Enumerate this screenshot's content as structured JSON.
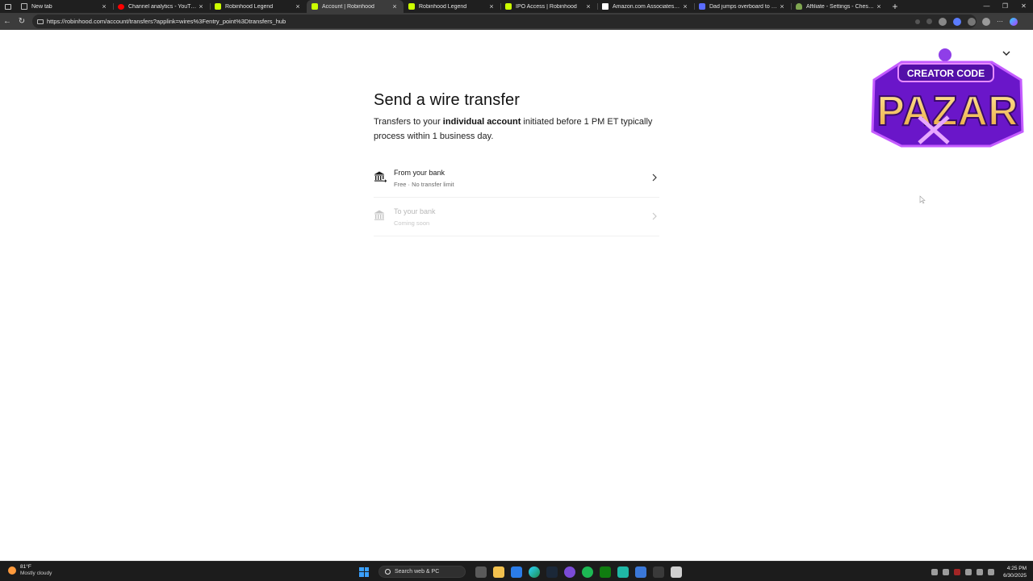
{
  "browser": {
    "tabs": [
      {
        "title": "New tab",
        "favicon": "page-icon",
        "active": false
      },
      {
        "title": "Channel analytics - YouTube Studio",
        "favicon": "youtube-icon",
        "active": false
      },
      {
        "title": "Robinhood Legend",
        "favicon": "robinhood-icon",
        "active": false
      },
      {
        "title": "Account | Robinhood",
        "favicon": "robinhood-icon",
        "active": true
      },
      {
        "title": "Robinhood Legend",
        "favicon": "robinhood-icon",
        "active": false
      },
      {
        "title": "IPO Access | Robinhood",
        "favicon": "robinhood-icon",
        "active": false
      },
      {
        "title": "Amazon.com Associates Central",
        "favicon": "amazon-icon",
        "active": false
      },
      {
        "title": "Dad jumps overboard to save daughter",
        "favicon": "news-icon",
        "active": false
      },
      {
        "title": "Affiliate - Settings - Chess.com",
        "favicon": "chess-icon",
        "active": false
      }
    ],
    "new_tab": "+",
    "url": "https://robinhood.com/account/transfers?applink=wires%3Fentry_point%3Dtransfers_hub"
  },
  "page": {
    "title": "Send a wire transfer",
    "subtitle_pre": "Transfers to your ",
    "subtitle_bold": "individual account",
    "subtitle_post": " initiated before 1 PM ET typically process within 1 business day.",
    "options": [
      {
        "label": "From your bank",
        "sub": "Free · No transfer limit",
        "disabled": false
      },
      {
        "label": "To your bank",
        "sub": "Coming soon",
        "disabled": true
      }
    ]
  },
  "overlay": {
    "top_text": "CREATOR CODE",
    "main_text": "PAZAR",
    "colors": {
      "purple": "#7a1fd6",
      "gold": "#f5c04a"
    }
  },
  "taskbar": {
    "weather_temp": "81°F",
    "weather_desc": "Mostly cloudy",
    "search_placeholder": "Search web & PC",
    "time": "4:25 PM",
    "date": "6/30/2025"
  }
}
